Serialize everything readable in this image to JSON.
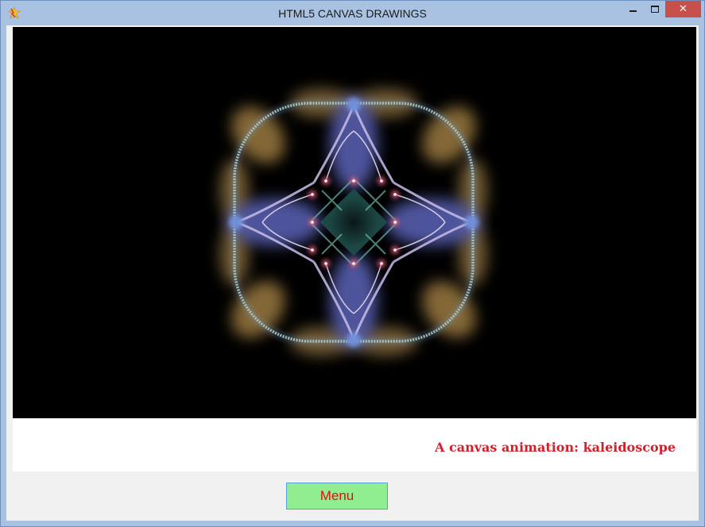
{
  "window": {
    "title": "HTML5 CANVAS DRAWINGS",
    "app_icon": "lightning-star-icon",
    "controls": {
      "minimize_icon": "minimize-icon",
      "maximize_icon": "maximize-icon",
      "close_icon": "close-icon",
      "close_glyph": "✕"
    }
  },
  "canvas": {
    "background": "#000000",
    "content": "kaleidoscope-animation"
  },
  "caption": {
    "text": "A canvas animation: kaleidoscope",
    "color": "#d4202a"
  },
  "menu_button": {
    "label": "Menu",
    "background": "#90ee90",
    "text_color": "#e01010"
  }
}
